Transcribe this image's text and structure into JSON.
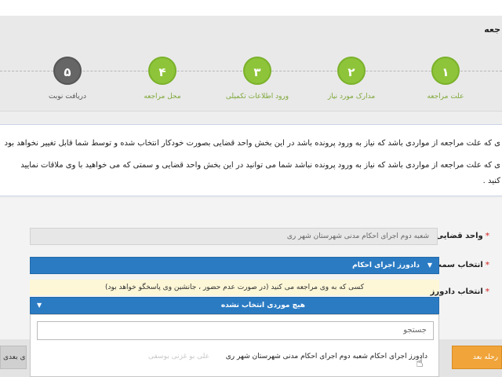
{
  "header": {
    "title": "جعه"
  },
  "steps": [
    {
      "number": "۱",
      "label": "علت مراجعه",
      "state": "done"
    },
    {
      "number": "۲",
      "label": "مدارک مورد نیاز",
      "state": "done"
    },
    {
      "number": "۳",
      "label": "ورود اطلاعات تکمیلی",
      "state": "done"
    },
    {
      "number": "۴",
      "label": "محل مراجعه",
      "state": "done"
    },
    {
      "number": "۵",
      "label": "دریافت نوبت",
      "state": "pending"
    }
  ],
  "info": {
    "line1": "ی که علت مراجعه از مواردی باشد که نیاز به ورود پرونده باشد در این بخش واحد قضایی بصورت خودکار انتخاب شده و توسط شما قابل تغییر نخواهد بود",
    "line2": "ی که علت مراجعه از مواردی باشد که نیاز به ورود پرونده نباشد شما می توانید در این بخش واحد قضایی و سمتی که می خواهید با وی ملاقات نمایید",
    "line3": "کنید ."
  },
  "form": {
    "judicial_unit": {
      "label": "واحد قضایی",
      "value": "شعبه دوم اجرای احکام مدنی شهرستان شهر ری"
    },
    "position": {
      "label": "انتخاب سمت",
      "value": "دادورز اجرای احکام"
    },
    "officer": {
      "label": "انتخاب دادورز",
      "hint": "کسی که به وی مراجعه می کنید (در صورت عدم حضور ، جانشین وی پاسخگو خواهد بود)",
      "value": "هیچ موردی انتخاب نشده"
    }
  },
  "dropdown": {
    "search_placeholder": "جستجو",
    "option": "دادورز اجرای احکام شعبه دوم اجرای احکام مدنی شهرستان شهر ری",
    "option_faint": "علی بو غزنی بوسفی"
  },
  "footer": {
    "next_label": "رحله بعد",
    "prev_label": "ی بعدی"
  },
  "colors": {
    "accent_blue": "#2b7bc3",
    "step_green": "#8ec43a",
    "button_orange": "#f0a43a"
  }
}
